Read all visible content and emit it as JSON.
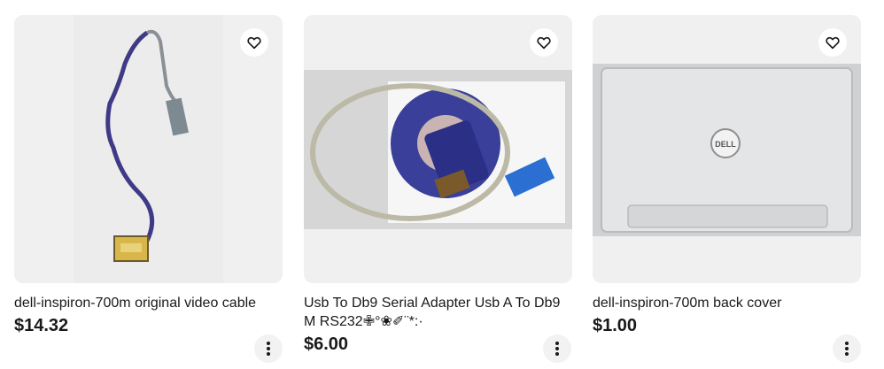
{
  "listings": [
    {
      "title": "dell-inspiron-700m original video cable",
      "price": "$14.32",
      "image_desc": "video cable",
      "save_icon": "heart-outline-icon",
      "more_icon": "vertical-ellipsis-icon"
    },
    {
      "title": "Usb To Db9 Serial Adapter Usb A To Db9 M RS232✙°❀✐¨*:·",
      "price": "$6.00",
      "image_desc": "usb serial adapter with cd",
      "save_icon": "heart-outline-icon",
      "more_icon": "vertical-ellipsis-icon"
    },
    {
      "title": "dell-inspiron-700m back cover",
      "price": "$1.00",
      "image_desc": "laptop back cover",
      "logo_text": "DELL",
      "save_icon": "heart-outline-icon",
      "more_icon": "vertical-ellipsis-icon"
    }
  ],
  "colors": {
    "text": "#191919",
    "image_bg": "#f0f0f0",
    "button_bg": "#f2f2f2"
  }
}
